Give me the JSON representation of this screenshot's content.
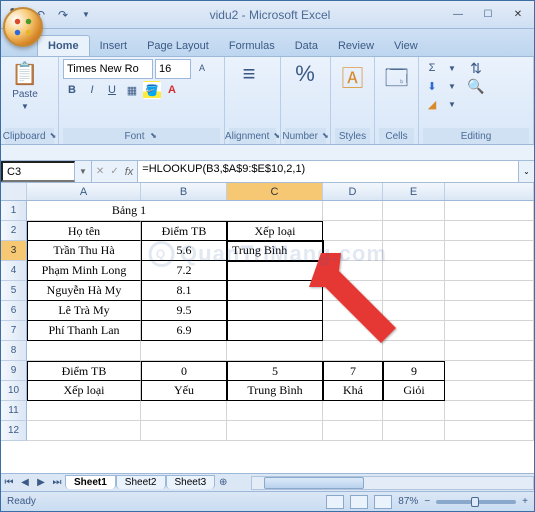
{
  "window": {
    "title": "vidu2 - Microsoft Excel"
  },
  "tabs": [
    "Home",
    "Insert",
    "Page Layout",
    "Formulas",
    "Data",
    "Review",
    "View"
  ],
  "ribbon": {
    "clipboard": {
      "label": "Clipboard",
      "paste": "Paste"
    },
    "font": {
      "label": "Font",
      "family": "Times New Ro",
      "size": "16"
    },
    "alignment": {
      "label": "Alignment"
    },
    "number": {
      "label": "Number"
    },
    "styles": {
      "label": "Styles"
    },
    "cells": {
      "label": "Cells"
    },
    "editing": {
      "label": "Editing"
    }
  },
  "formula_bar": {
    "name_box": "C3",
    "formula": "=HLOOKUP(B3,$A$9:$E$10,2,1)"
  },
  "columns": {
    "A": 114,
    "B": 86,
    "C": 96,
    "D": 60,
    "E": 62
  },
  "grid": {
    "row1": {
      "A": "Bảng 1"
    },
    "row2": {
      "A": "Họ tên",
      "B": "Điểm TB",
      "C": "Xếp loại"
    },
    "row3": {
      "A": "Trần Thu Hà",
      "B": "5.6",
      "C": "Trung Bình"
    },
    "row4": {
      "A": "Phạm Minh Long",
      "B": "7.2"
    },
    "row5": {
      "A": "Nguyễn Hà My",
      "B": "8.1"
    },
    "row6": {
      "A": "Lê Trà My",
      "B": "9.5"
    },
    "row7": {
      "A": "Phí Thanh Lan",
      "B": "6.9"
    },
    "row9": {
      "A": "Điểm TB",
      "B": "0",
      "C": "5",
      "D": "7",
      "E": "9"
    },
    "row10": {
      "A": "Xếp loại",
      "B": "Yếu",
      "C": "Trung Bình",
      "D": "Khá",
      "E": "Giỏi"
    }
  },
  "sheets": [
    "Sheet1",
    "Sheet2",
    "Sheet3"
  ],
  "status": {
    "ready": "Ready",
    "zoom": "87%"
  },
  "watermark": "QuanTriMang.com"
}
